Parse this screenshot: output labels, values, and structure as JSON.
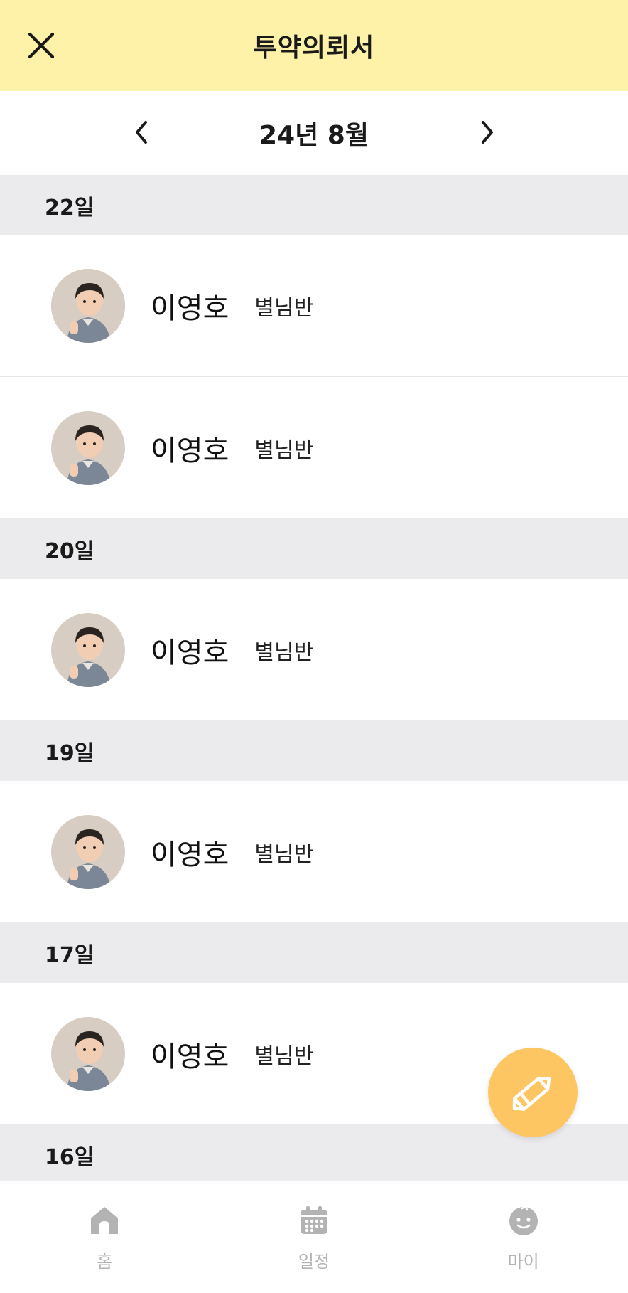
{
  "header": {
    "title": "투약의뢰서",
    "close_icon": "close-icon"
  },
  "month_nav": {
    "label": "24년 8월",
    "prev_icon": "chevron-left-icon",
    "next_icon": "chevron-right-icon"
  },
  "groups": [
    {
      "date": "22일",
      "entries": [
        {
          "name": "이영호",
          "class": "별님반"
        },
        {
          "name": "이영호",
          "class": "별님반"
        }
      ]
    },
    {
      "date": "20일",
      "entries": [
        {
          "name": "이영호",
          "class": "별님반"
        }
      ]
    },
    {
      "date": "19일",
      "entries": [
        {
          "name": "이영호",
          "class": "별님반"
        }
      ]
    },
    {
      "date": "17일",
      "entries": [
        {
          "name": "이영호",
          "class": "별님반"
        }
      ]
    },
    {
      "date": "16일",
      "entries": []
    }
  ],
  "fab": {
    "icon": "pencil-icon",
    "color": "#fdc663"
  },
  "tabbar": {
    "items": [
      {
        "label": "홈",
        "icon": "home-icon"
      },
      {
        "label": "일정",
        "icon": "calendar-icon"
      },
      {
        "label": "마이",
        "icon": "baby-face-icon"
      }
    ],
    "inactive_color": "#b3b3b3"
  },
  "colors": {
    "header_bg": "#fef1a8",
    "date_header_bg": "#ebeaec",
    "accent": "#fdc663"
  }
}
